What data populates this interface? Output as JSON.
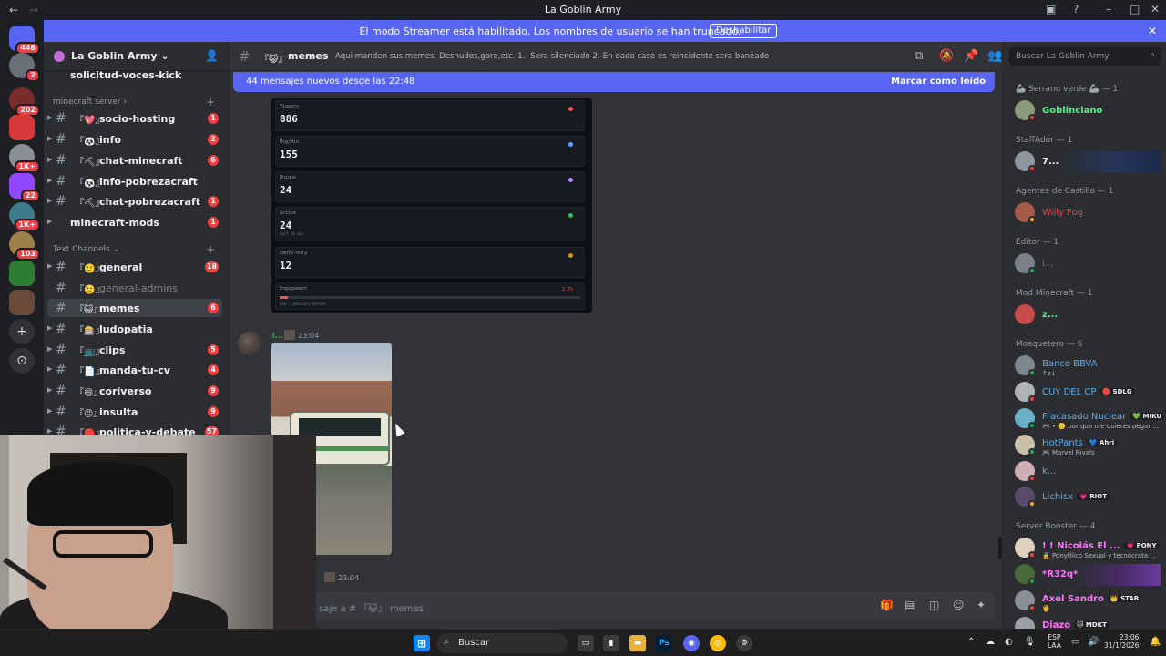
{
  "window": {
    "title": "La Goblin Army"
  },
  "banner": {
    "text": "El modo Streamer está habilitado. Los nombres de usuario se han truncado.",
    "button": "Deshabilitar"
  },
  "guilds": [
    {
      "badge": "448"
    },
    {
      "badge": "2"
    },
    {
      "badge": "202"
    },
    {
      "badge": ""
    },
    {
      "badge": "1K+"
    },
    {
      "badge": "22"
    },
    {
      "badge": "1K+"
    },
    {
      "badge": "103"
    },
    {
      "badge": ""
    },
    {
      "badge": ""
    }
  ],
  "server": {
    "name": "La Goblin Army ⌄"
  },
  "sidebar": {
    "top_channel": "solicitud-voces-kick",
    "categories": [
      {
        "label": "minecraft server ›"
      },
      {
        "label": "Text Channels ⌄"
      }
    ],
    "mc_channels": [
      {
        "emoji": "『💖』",
        "label": "socio-hosting",
        "badge": "1"
      },
      {
        "emoji": "『🐼』",
        "label": "info",
        "badge": "2"
      },
      {
        "emoji": "『⛏』",
        "label": "chat-minecraft",
        "badge": "6"
      },
      {
        "emoji": "『🐼』",
        "label": "info-pobrezacraft",
        "badge": ""
      },
      {
        "emoji": "『⛏』",
        "label": "chat-pobrezacraft",
        "badge": "1"
      }
    ],
    "mc_mods": {
      "label": "minecraft-mods",
      "badge": "1"
    },
    "text_channels": [
      {
        "emoji": "『🙂』",
        "label": "general",
        "badge": "18"
      },
      {
        "emoji": "『🙂』",
        "label": "general-admins",
        "badge": ""
      },
      {
        "emoji": "『😺』",
        "label": "memes",
        "badge": "6"
      },
      {
        "emoji": "『🎰』",
        "label": "ludopatia",
        "badge": ""
      },
      {
        "emoji": "『📺』",
        "label": "clips",
        "badge": "5"
      },
      {
        "emoji": "『📄』",
        "label": "manda-tu-cv",
        "badge": "4"
      },
      {
        "emoji": "『😄』",
        "label": "coriverso",
        "badge": "9"
      },
      {
        "emoji": "『😡』",
        "label": "insulta",
        "badge": "9"
      },
      {
        "emoji": "『🔴』",
        "label": "politica-y-debate",
        "badge": "57"
      }
    ]
  },
  "channel": {
    "emoji": "『😺』",
    "name": "memes",
    "topic": "Aqui manden sus memes. Desnudos,gore,etc. 1.- Sera silenciado 2.-En dado caso es reincidente sera baneado"
  },
  "new_messages": {
    "text": "44 mensajes nuevos desde las 22:48",
    "action": "Marcar como leído"
  },
  "stats_card": [
    {
      "key": "Viewers",
      "value": "886",
      "color": "#f85149"
    },
    {
      "key": "Msg/Min",
      "value": "155",
      "color": "#58a6ff"
    },
    {
      "key": "Unique",
      "value": "24",
      "color": "#bc8cff"
    },
    {
      "key": "Active",
      "value": "24",
      "sub": "Last 10 min",
      "color": "#3fb950"
    },
    {
      "key": "Emote-Only",
      "value": "12",
      "color": "#d29922"
    },
    {
      "key": "Engagement",
      "pct": "2.7%",
      "sub": "Low - possibly botted",
      "fill": 0.027
    }
  ],
  "message": {
    "author": "i...",
    "time": "23:04"
  },
  "message2": {
    "time": "23:04"
  },
  "composer": {
    "placeholder": "saje a # 『😺』 memes"
  },
  "members_search": {
    "placeholder": "Buscar La Goblin Army"
  },
  "members": [
    {
      "category": "🦾 Serrano verde 🦾 — 1"
    },
    {
      "name": "Goblinciano",
      "color": "#57f287"
    },
    {
      "category": "StaffAdor — 1"
    },
    {
      "name": "7...",
      "color": "#f2f3f5"
    },
    {
      "category": "Agentes de Castillo — 1"
    },
    {
      "name": "Willy Fog",
      "color": "#ed4245"
    },
    {
      "category": "Editor — 1"
    },
    {
      "name": "i...",
      "color": "#ed4245"
    },
    {
      "category": "Mod Minecraft — 1"
    },
    {
      "name": "z...",
      "color": "#57f287"
    },
    {
      "category": "Mosquetero — 6"
    },
    {
      "name": "Banco BBVA",
      "color": "#5dadec",
      "sub": "↑z↓"
    },
    {
      "name": "CUY DEL CP",
      "color": "#5dadec",
      "tag": "🔴 SDLG"
    },
    {
      "name": "Fracasado Nuclear",
      "color": "#5dadec",
      "tag": "💚 MIKU",
      "sub": "🎮 • 🙂 por que me quieres pegar ..."
    },
    {
      "name": "HotPants",
      "color": "#5dadec",
      "tag": "💙 Ahri",
      "sub": "🎮 Marvel Rivals"
    },
    {
      "name": "k...",
      "color": "#5dadec"
    },
    {
      "name": "Lichisx",
      "color": "#5dadec",
      "tag": "💗 RIOT"
    },
    {
      "category": "Server Booster — 4"
    },
    {
      "name": "! ! Nicolás El ...",
      "color": "#ff73fa",
      "tag": "💗 PONY",
      "sub": "🔒 Ponyfilico Sexual y tecnócrata ..."
    },
    {
      "name": "*R32q*",
      "color": "#ff73fa"
    },
    {
      "name": "Axel Sandro",
      "color": "#ff73fa",
      "tag": "👑 STAR",
      "sub": "🖐"
    },
    {
      "name": "Diazo",
      "color": "#ff73fa",
      "tag": "🐱 MDKT"
    }
  ],
  "taskbar": {
    "search": "Buscar",
    "lang": "ESP\nLAA",
    "time": "23:06",
    "date": "31/1/2026"
  }
}
